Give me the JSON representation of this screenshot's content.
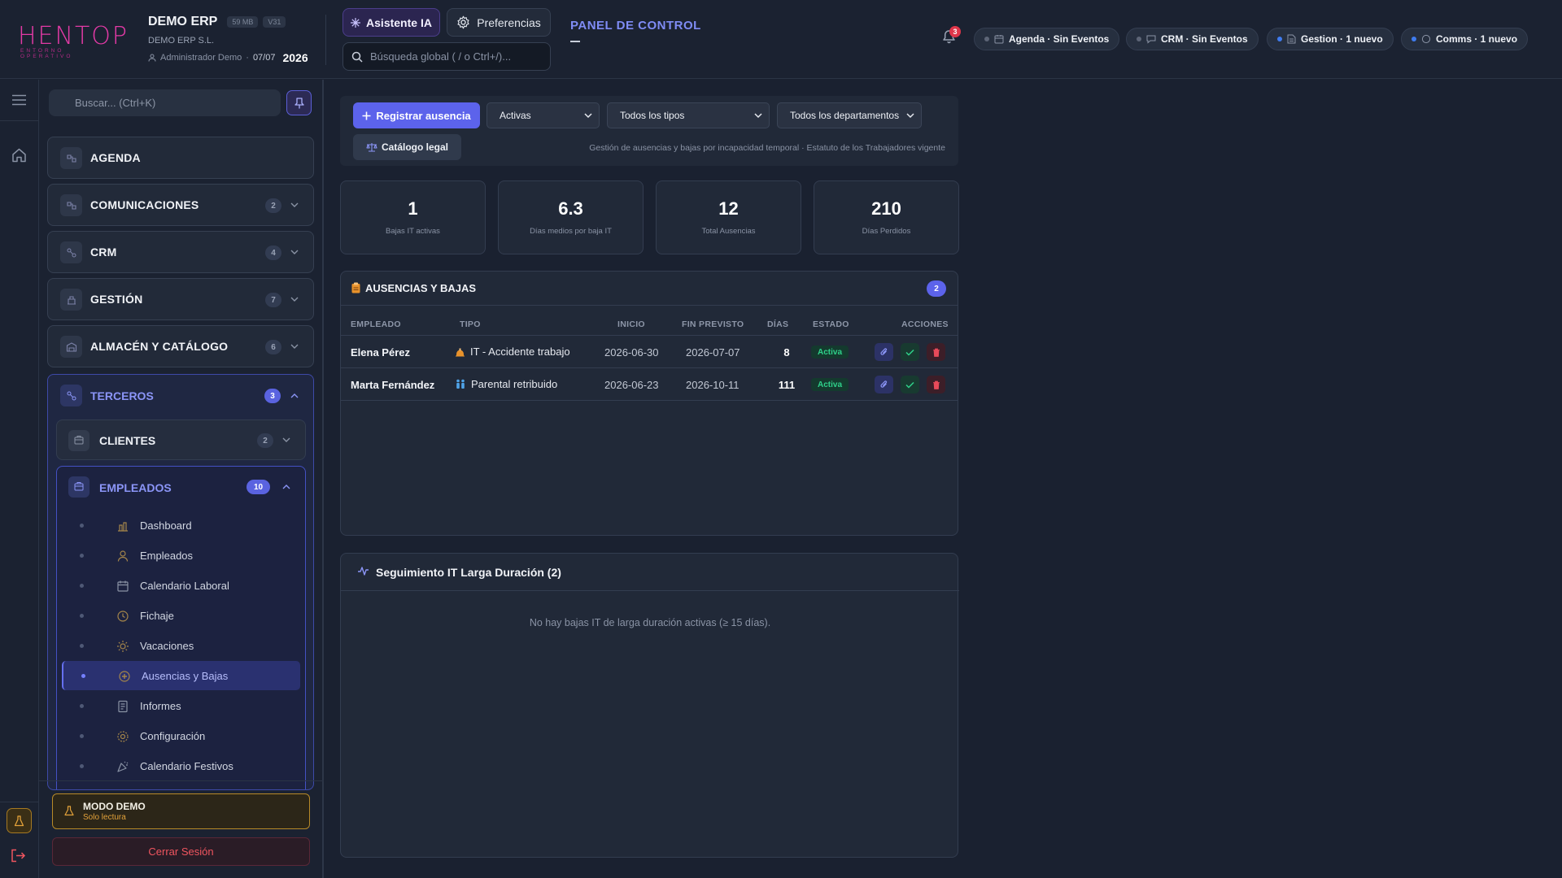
{
  "header": {
    "logo_text": "HENTOP",
    "logo_subtitle": "ENTORNO OPERATIVO",
    "company_name": "DEMO ERP",
    "size_chip": "59 MB",
    "version_chip": "V31",
    "company_legal": "DEMO ERP S.L.",
    "user": "Administrador Demo",
    "date": "07/07",
    "year": "2026",
    "ai_button": "Asistente IA",
    "prefs_button": "Preferencias",
    "search_placeholder": "Búsqueda global ( / o Ctrl+/)...",
    "panel_title": "PANEL DE CONTROL",
    "notifications_count": "3",
    "status_pills": [
      {
        "label": "Agenda · Sin Eventos",
        "dot": "#5d6577"
      },
      {
        "label": "CRM · Sin Eventos",
        "dot": "#5d6577"
      },
      {
        "label": "Gestion · 1 nuevo",
        "dot": "#3f7cf0"
      },
      {
        "label": "Comms · 1 nuevo",
        "dot": "#3f7cf0"
      }
    ]
  },
  "sidebar": {
    "search_placeholder": "Buscar... (Ctrl+K)",
    "sections": [
      {
        "label": "AGENDA",
        "count": null
      },
      {
        "label": "COMUNICACIONES",
        "count": "2"
      },
      {
        "label": "CRM",
        "count": "4"
      },
      {
        "label": "GESTIÓN",
        "count": "7"
      },
      {
        "label": "ALMACÉN Y CATÁLOGO",
        "count": "6"
      }
    ],
    "terceros": {
      "label": "TERCEROS",
      "count": "3",
      "clientes": {
        "label": "CLIENTES",
        "count": "2"
      },
      "empleados": {
        "label": "EMPLEADOS",
        "count": "10",
        "items": [
          {
            "label": "Dashboard"
          },
          {
            "label": "Empleados"
          },
          {
            "label": "Calendario Laboral"
          },
          {
            "label": "Fichaje"
          },
          {
            "label": "Vacaciones"
          },
          {
            "label": "Ausencias y Bajas"
          },
          {
            "label": "Informes"
          },
          {
            "label": "Configuración"
          },
          {
            "label": "Calendario Festivos"
          }
        ],
        "active_index": 5
      }
    },
    "demo_mode": {
      "title": "MODO DEMO",
      "subtitle": "Solo lectura"
    },
    "logout": "Cerrar Sesión"
  },
  "toolbar": {
    "register_button": "Registrar ausencia",
    "filter_status": "Activas",
    "filter_type": "Todos los tipos",
    "filter_department": "Todos los departamentos",
    "legal_catalog_button": "Catálogo legal",
    "legal_note": "Gestión de ausencias y bajas por incapacidad temporal · Estatuto de los Trabajadores vigente"
  },
  "kpis": [
    {
      "value": "1",
      "label": "Bajas IT activas"
    },
    {
      "value": "6.3",
      "label": "Días medios por baja IT"
    },
    {
      "value": "12",
      "label": "Total Ausencias"
    },
    {
      "value": "210",
      "label": "Días Perdidos"
    }
  ],
  "absences": {
    "title": "AUSENCIAS Y BAJAS",
    "count": "2",
    "columns": [
      "EMPLEADO",
      "TIPO",
      "INICIO",
      "FIN PREVISTO",
      "DÍAS",
      "ESTADO",
      "ACCIONES"
    ],
    "rows": [
      {
        "employee": "Elena Pérez",
        "type": "IT - Accidente trabajo",
        "type_icon": "construction-icon",
        "start": "2026-06-30",
        "end": "2026-07-07",
        "days": "8",
        "status": "Activa"
      },
      {
        "employee": "Marta Fernández",
        "type": "Parental retribuido",
        "type_icon": "family-icon",
        "start": "2026-06-23",
        "end": "2026-10-11",
        "days": "111",
        "status": "Activa"
      }
    ]
  },
  "long_it": {
    "title": "Seguimiento IT Larga Duración (2)",
    "empty_text": "No hay bajas IT de larga duración activas (≥ 15 días)."
  },
  "colors": {
    "accent": "#5c63eb",
    "brand": "#e33aa6",
    "success": "#2fd18a",
    "danger": "#f0555f",
    "warning": "#e3a23a"
  }
}
